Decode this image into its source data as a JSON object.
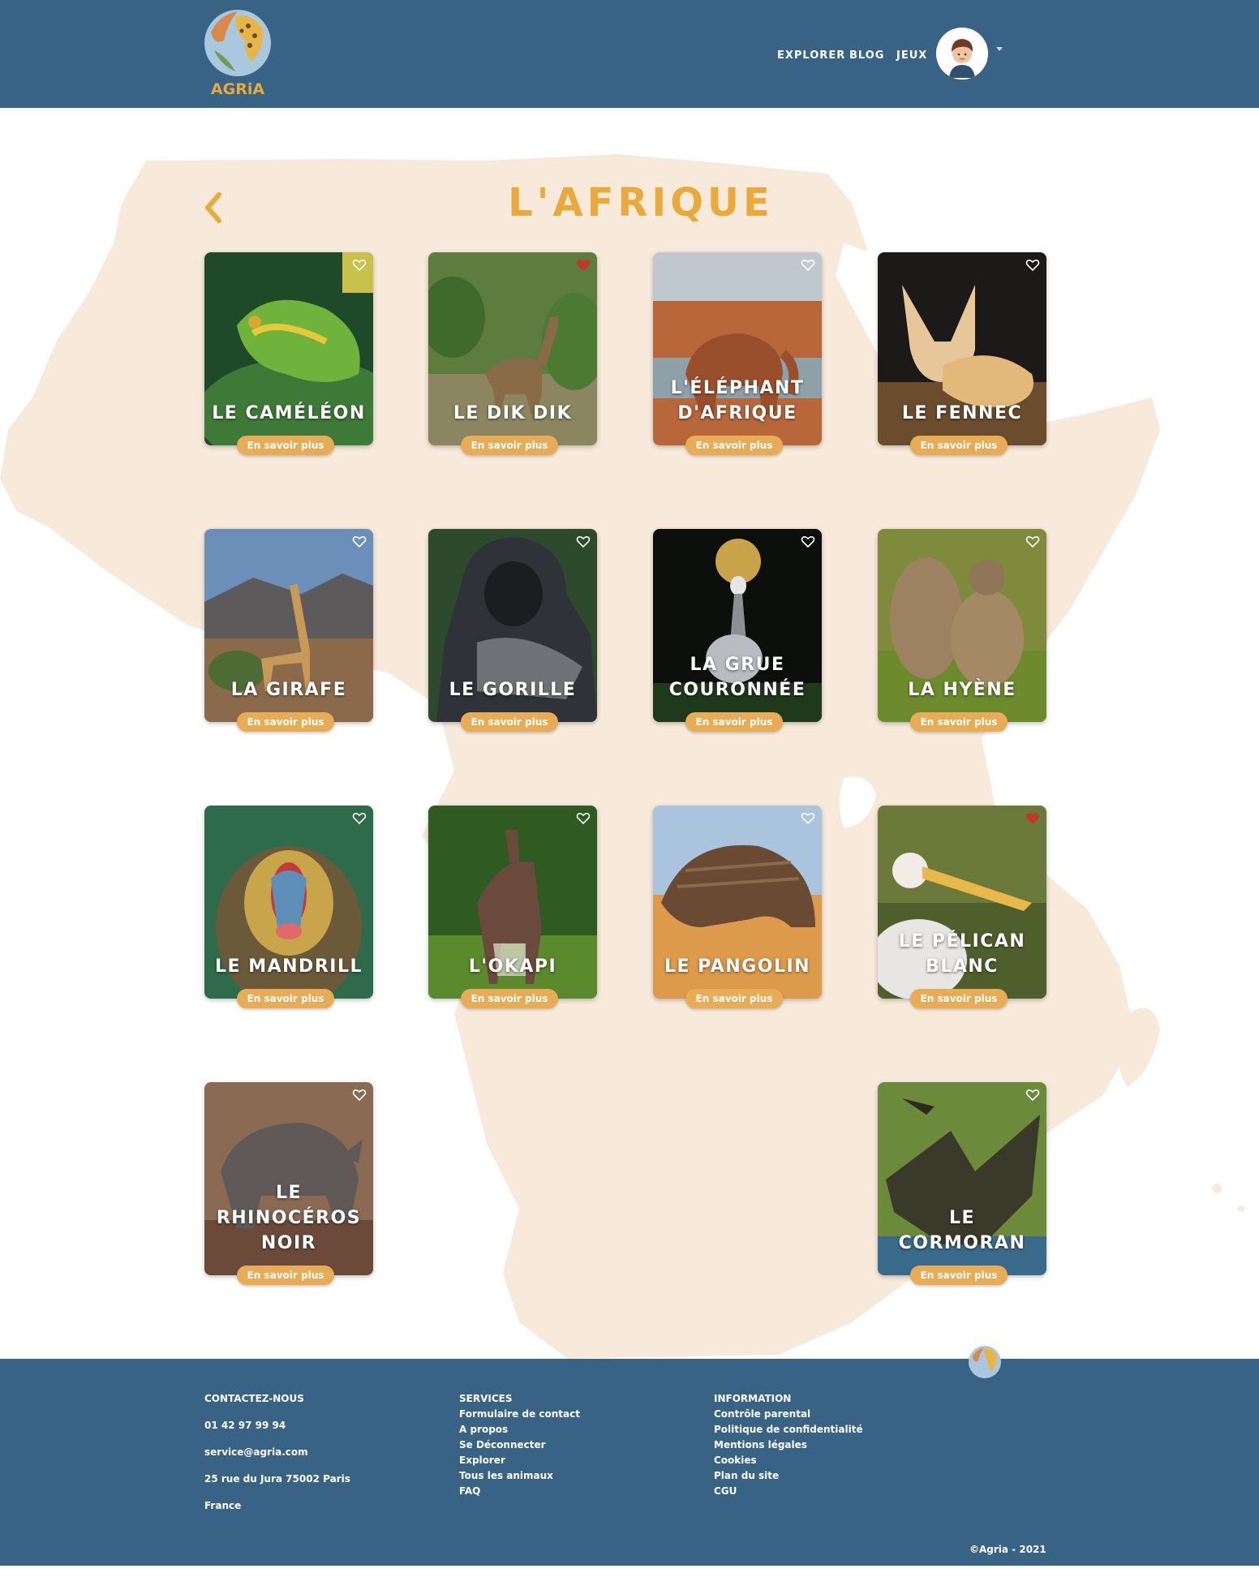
{
  "header": {
    "logo_text": "AGRiA",
    "nav": [
      "EXPLORER",
      "BLOG",
      "JEUX"
    ],
    "avatar_icon": "user-avatar-icon"
  },
  "main": {
    "title": "L'AFRIQUE",
    "back_icon": "chevron-left-icon",
    "more_label": "En savoir plus",
    "cards": [
      {
        "name": "LE CAMÉLÉON",
        "favorite": false
      },
      {
        "name": "LE DIK DIK",
        "favorite": true
      },
      {
        "name": "L'ÉLÉPHANT D'AFRIQUE",
        "favorite": false
      },
      {
        "name": "LE FENNEC",
        "favorite": false
      },
      {
        "name": "LA GIRAFE",
        "favorite": false
      },
      {
        "name": "LE GORILLE",
        "favorite": false
      },
      {
        "name": "LA GRUE COURONNÉE",
        "favorite": false
      },
      {
        "name": "LA HYÈNE",
        "favorite": false
      },
      {
        "name": "LE MANDRILL",
        "favorite": false
      },
      {
        "name": "L'OKAPI",
        "favorite": false
      },
      {
        "name": "LE PANGOLIN",
        "favorite": false
      },
      {
        "name": "LE PÉLICAN BLANC",
        "favorite": true
      },
      {
        "name": "LE RHINOCÉROS NOIR",
        "favorite": false
      },
      {
        "name": "LE CORMORAN",
        "favorite": false
      }
    ]
  },
  "footer": {
    "contact": {
      "heading": "CONTACTEZ-NOUS",
      "phone": "01 42 97 99 94",
      "email": "service@agria.com",
      "address": "25 rue du Jura 75002 Paris",
      "country": "France"
    },
    "services": {
      "heading": "SERVICES",
      "links": [
        "Formulaire de contact",
        "A propos",
        "Se Déconnecter",
        "Explorer",
        "Tous les animaux",
        "FAQ"
      ]
    },
    "information": {
      "heading": "INFORMATION",
      "links": [
        "Contrôle parental",
        "Politique de confidentialité",
        "Mentions légales",
        "Cookies",
        "Plan du site",
        "CGU"
      ]
    },
    "copyright": "©Agria - 2021"
  },
  "colors": {
    "header_bg": "#386384",
    "accent": "#e8a93d",
    "button": "#e8ac57",
    "map": "#f7eadb",
    "favorite": "#c0392b"
  }
}
